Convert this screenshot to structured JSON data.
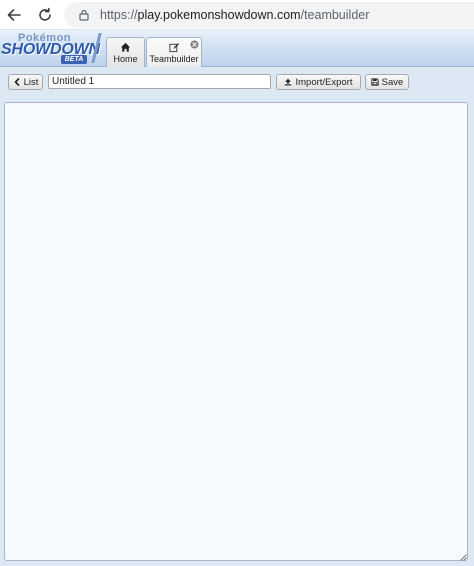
{
  "browser": {
    "url_scheme": "https://",
    "url_host": "play.pokemonshowdown.com",
    "url_path": "/teambuilder",
    "back_icon": "arrow-left-icon",
    "reload_icon": "reload-icon",
    "lock_icon": "lock-icon"
  },
  "header": {
    "logo": {
      "line1": "Pokémon",
      "line2": "SHOWDOWN",
      "badge": "BETA"
    },
    "tabs": [
      {
        "label": "Home",
        "icon": "home-icon"
      },
      {
        "label": "Teambuilder",
        "icon": "edit-icon",
        "close_icon": "close-circle-icon"
      }
    ]
  },
  "toolbar": {
    "list_label": "List",
    "list_icon": "chevron-left-icon",
    "team_name": "Untitled 1",
    "import_label": "Import/Export",
    "import_icon": "upload-icon",
    "save_label": "Save",
    "save_icon": "floppy-icon"
  },
  "editor": {
    "content": ""
  },
  "colors": {
    "header_gradient_top": "#eaf2fb",
    "header_gradient_bottom": "#bfd3ec",
    "main_background": "#dde8f5",
    "logo_blue": "#2f5aa8"
  }
}
